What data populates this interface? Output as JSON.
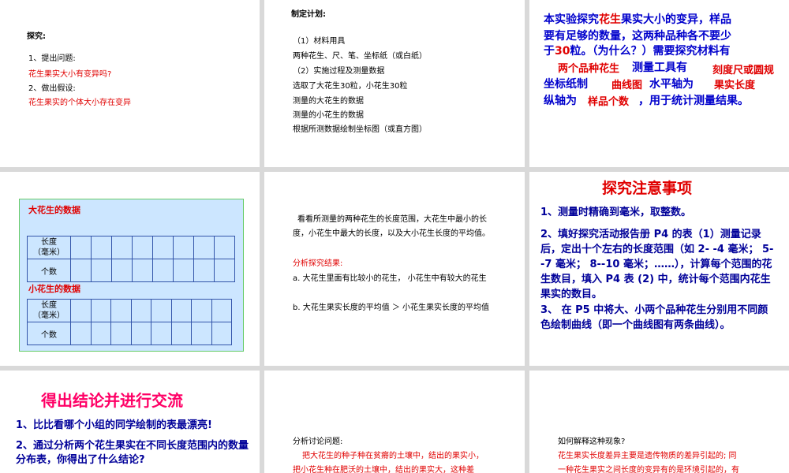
{
  "slide1": {
    "heading": "探究:",
    "item1": "1、提出问题:",
    "question": "花生果实大小有变异吗?",
    "item2": "2、做出假设:",
    "hypothesis": "花生果实的个体大小存在变异"
  },
  "slide2": {
    "heading": "制定计划:",
    "lines": [
      "（1）材料用具",
      "两种花生、尺、笔、坐标纸（或白纸）",
      "（2）实施过程及测量数据",
      "选取了大花生30粒，小花生30粒",
      "测量的大花生的数据",
      "测量的小花生的数据",
      "根据所测数据绘制坐标图（或直方图）"
    ]
  },
  "slide3": {
    "line1_a": "本实验探究",
    "line1_red": "花生",
    "line1_b": "果实大小的变异，样品",
    "line2": "要有足够的数量，这两种品种各不要少",
    "line3_a": "于",
    "line3_red": "30",
    "line3_b": "粒。（为什么？）需要探究材料有",
    "fill_two_varieties": "两个品种花生",
    "measure_tools": "测量工具有",
    "fill_ruler": "刻度尺或圆规",
    "graph_paper": "坐标纸制",
    "fill_curve": "曲线图",
    "horizontal_axis": "水平轴为",
    "fill_length": "果实长度",
    "vertical_axis": "纵轴为",
    "fill_count": "样品个数",
    "tail": "，用于统计测量结果。"
  },
  "slide4": {
    "big_title": "大花生的数据",
    "small_title": "小花生的数据",
    "row_length": "长度\n（毫米）",
    "row_count": "个数"
  },
  "slide5": {
    "para": "看看所测量的两种花生的长度范围，大花生中最小的长度，小花生中最大的长度，以及大小花生长度的平均值。",
    "result_label": "分析探究结果:",
    "result_a": "a. 大花生里面有比较小的花生，  小花生中有较大的花生",
    "result_b": "b. 大花生果实长度的平均值 ＞ 小花生果实长度的平均值"
  },
  "slide6": {
    "title": "探究注意事项",
    "p1": "1、测量时精确到毫米，取整数。",
    "p2": "2、填好探究活动报告册 P4 的表（1）测量记录后，定出十个左右的长度范围（如 2- -4 毫米； 5--7 毫米； 8--10 毫米；……），计算每个范围的花生数目，填入 P4 表 (2) 中，统计每个范围内花生果实的数目。",
    "p3": "3、 在 P5 中将大、小两个品种花生分别用不同颜色绘制曲线（即一个曲线图有两条曲线）。"
  },
  "slide7": {
    "title": "得出结论并进行交流",
    "q1": "1、比比看哪个小组的同学绘制的表最漂亮!",
    "q2": "2、通过分析两个花生果实在不同长度范围内的数量分布表，你得出了什么结论?"
  },
  "slide8": {
    "heading": "分析讨论问题:",
    "line1": "把大花生的种子种在贫瘠的土壤中，结出的果实小，",
    "line2": "把小花生种在肥沃的土壤中，结出的果实大，这种差"
  },
  "slide9": {
    "heading": "如何解释这种现象?",
    "line1": "花生果实长度差异主要是遗传物质的差异引起的; 同",
    "line2": "一种花生果实之间长度的变异有的是环境引起的，有"
  }
}
